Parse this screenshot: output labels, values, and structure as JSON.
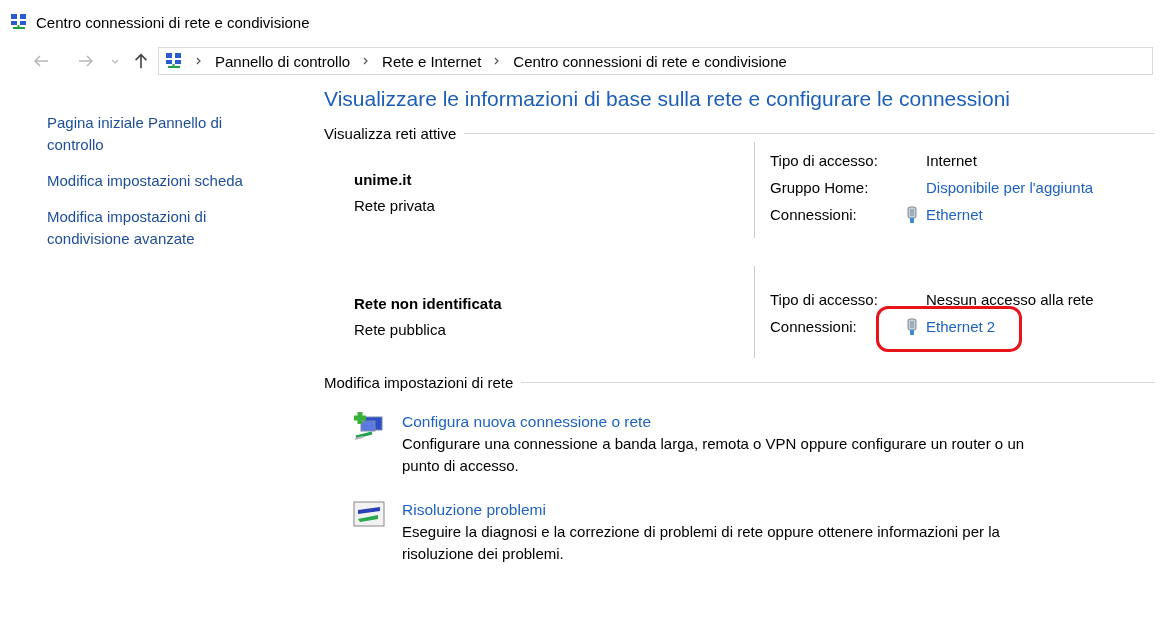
{
  "window": {
    "title": "Centro connessioni di rete e condivisione"
  },
  "breadcrumb": [
    "Pannello di controllo",
    "Rete e Internet",
    "Centro connessioni di rete e condivisione"
  ],
  "sidebar": {
    "items": [
      {
        "label": "Pagina iniziale Pannello di controllo"
      },
      {
        "label": "Modifica impostazioni scheda"
      },
      {
        "label": "Modifica impostazioni di condivisione avanzate"
      }
    ]
  },
  "heading": "Visualizzare le informazioni di base sulla rete e configurare le connessioni",
  "active_networks": {
    "title": "Visualizza reti attive",
    "networks": [
      {
        "name": "unime.it",
        "type": "Rete privata",
        "rows": [
          {
            "label": "Tipo di accesso:",
            "value": "Internet",
            "kind": "text",
            "highlighted": false
          },
          {
            "label": "Gruppo Home:",
            "value": "Disponibile per l'aggiunta",
            "kind": "link",
            "highlighted": false
          },
          {
            "label": "Connessioni:",
            "value": "Ethernet",
            "kind": "adapter",
            "highlighted": false
          }
        ]
      },
      {
        "name": "Rete non identificata",
        "type": "Rete pubblica",
        "rows": [
          {
            "label": "Tipo di accesso:",
            "value": "Nessun accesso alla rete",
            "kind": "text",
            "highlighted": false
          },
          {
            "label": "Connessioni:",
            "value": "Ethernet 2",
            "kind": "adapter",
            "highlighted": true
          }
        ]
      }
    ]
  },
  "change_settings": {
    "title": "Modifica impostazioni di rete",
    "tasks": [
      {
        "kind": "new-connection",
        "link": "Configura nuova connessione o rete",
        "description": "Configurare una connessione a banda larga, remota o VPN oppure configurare un router o un punto di accesso."
      },
      {
        "kind": "troubleshoot",
        "link": "Risoluzione problemi",
        "description": "Eseguire la diagnosi e la correzione di problemi di rete oppure ottenere informazioni per la risoluzione dei problemi."
      }
    ]
  }
}
